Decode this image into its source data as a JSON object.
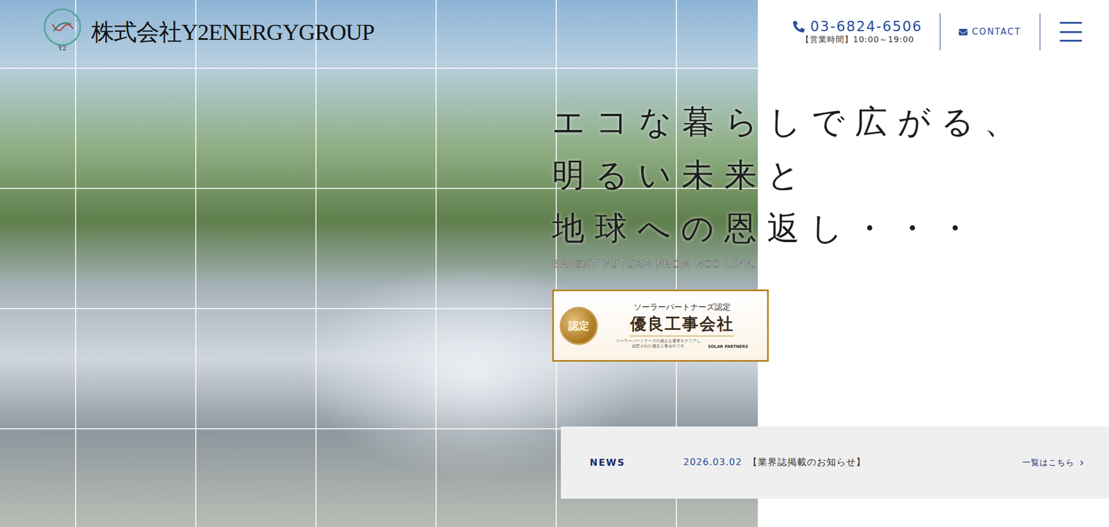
{
  "header": {
    "logo_mark": "Y2",
    "company": "株式会社Y2ENERGYGROUP",
    "phone": "03-6824-6506",
    "hours": "【営業時間】10:00～19:00",
    "contact": "CONTACT"
  },
  "hero": {
    "lines": [
      "エコな暮らしで広がる、",
      "明るい未来と",
      "地球への恩返し・・・"
    ],
    "subtitle": "BRIGHT FUTURE FROM ECO LIFE."
  },
  "badge": {
    "title": "ソーラーパートナーズ認定",
    "seal": "認定",
    "name": "優良工事会社",
    "note": [
      "ソーラーパートナーズの厳正な審査をクリアし、",
      "認定された優良工事会社です。"
    ],
    "brand": "SOLAR PARTNERS"
  },
  "news": {
    "label": "NEWS",
    "items": [
      {
        "date": "2026.03.02",
        "title": "【業界誌掲載のお知らせ】"
      }
    ],
    "more": "一覧はこちら"
  }
}
